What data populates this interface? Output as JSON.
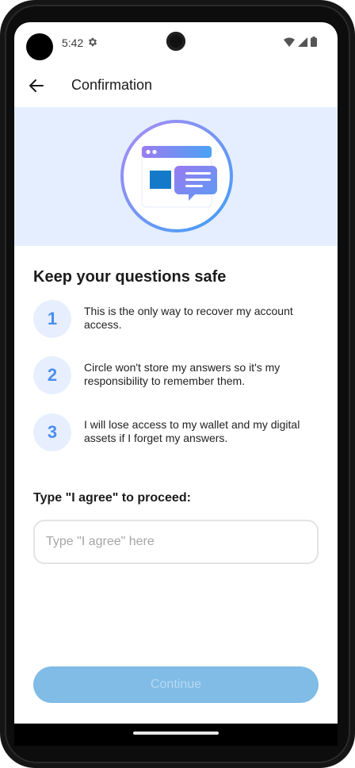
{
  "status_bar": {
    "time": "5:42",
    "icons": [
      "gear-icon",
      "wifi-icon",
      "signal-icon",
      "battery-icon"
    ]
  },
  "app_bar": {
    "title": "Confirmation",
    "back_icon": "arrow-left-icon"
  },
  "hero": {
    "illustration": "browser-chat-illustration"
  },
  "content": {
    "title": "Keep your questions safe",
    "steps": [
      {
        "number": "1",
        "text": "This is the only way to recover my account access."
      },
      {
        "number": "2",
        "text": "Circle won't store my answers so it's my responsibility to remember them."
      },
      {
        "number": "3",
        "text": "I will lose access to my wallet and my digital assets if I forget my answers."
      }
    ],
    "agree_label": "Type \"I agree\" to proceed:",
    "agree_input": {
      "value": "",
      "placeholder": "Type \"I agree\" here"
    },
    "continue_label": "Continue"
  },
  "colors": {
    "hero_background": "#e5eeff",
    "badge_background": "#e7efff",
    "badge_text": "#4c8ef0",
    "button_disabled": "#80bce6"
  }
}
